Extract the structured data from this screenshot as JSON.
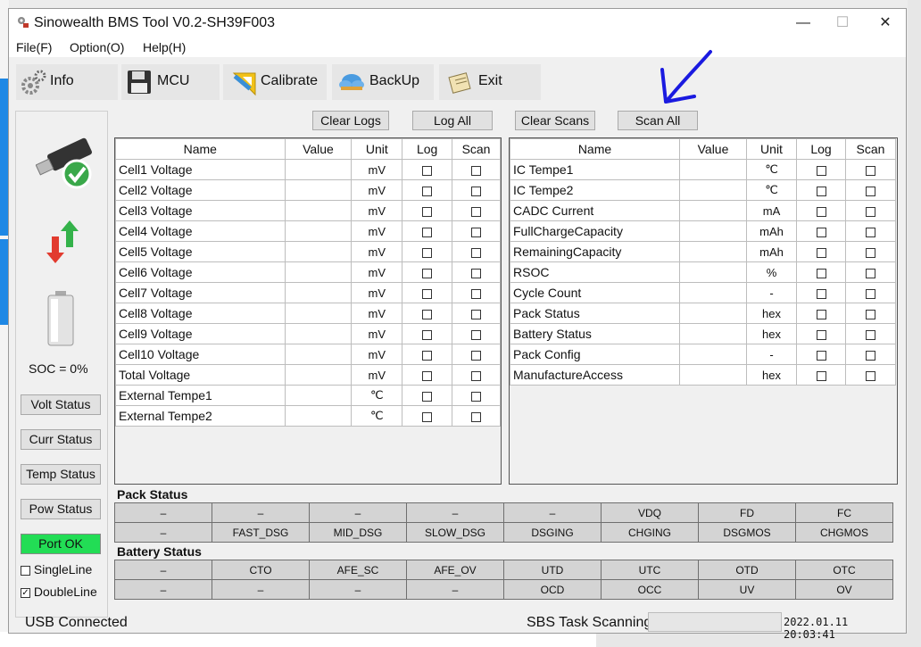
{
  "window": {
    "title": "Sinowealth BMS Tool V0.2-SH39F003",
    "controls": {
      "minimize": "—",
      "maximize": "☐",
      "close": "✕"
    }
  },
  "menu": [
    "File(F)",
    "Option(O)",
    "Help(H)"
  ],
  "toolbar": [
    {
      "label": "Info",
      "icon": "gear-icon"
    },
    {
      "label": "MCU",
      "icon": "floppy-disk-icon"
    },
    {
      "label": "Calibrate",
      "icon": "ruler-triangle-icon"
    },
    {
      "label": "BackUp",
      "icon": "cloud-icon"
    },
    {
      "label": "Exit",
      "icon": "exit-icon"
    }
  ],
  "actions": {
    "clear_logs": "Clear Logs",
    "log_all": "Log All",
    "clear_scans": "Clear Scans",
    "scan_all": "Scan All"
  },
  "columns": {
    "name": "Name",
    "value": "Value",
    "unit": "Unit",
    "log": "Log",
    "scan": "Scan"
  },
  "left_table": [
    {
      "name": "Cell1 Voltage",
      "value": "",
      "unit": "mV"
    },
    {
      "name": "Cell2 Voltage",
      "value": "",
      "unit": "mV"
    },
    {
      "name": "Cell3 Voltage",
      "value": "",
      "unit": "mV"
    },
    {
      "name": "Cell4 Voltage",
      "value": "",
      "unit": "mV"
    },
    {
      "name": "Cell5 Voltage",
      "value": "",
      "unit": "mV"
    },
    {
      "name": "Cell6 Voltage",
      "value": "",
      "unit": "mV"
    },
    {
      "name": "Cell7 Voltage",
      "value": "",
      "unit": "mV"
    },
    {
      "name": "Cell8 Voltage",
      "value": "",
      "unit": "mV"
    },
    {
      "name": "Cell9 Voltage",
      "value": "",
      "unit": "mV"
    },
    {
      "name": "Cell10 Voltage",
      "value": "",
      "unit": "mV"
    },
    {
      "name": "Total Voltage",
      "value": "",
      "unit": "mV"
    },
    {
      "name": "External Tempe1",
      "value": "",
      "unit": "℃"
    },
    {
      "name": "External Tempe2",
      "value": "",
      "unit": "℃"
    }
  ],
  "right_table": [
    {
      "name": "IC Tempe1",
      "value": "",
      "unit": "℃"
    },
    {
      "name": "IC Tempe2",
      "value": "",
      "unit": "℃"
    },
    {
      "name": "CADC Current",
      "value": "",
      "unit": "mA"
    },
    {
      "name": "FullChargeCapacity",
      "value": "",
      "unit": "mAh"
    },
    {
      "name": "RemainingCapacity",
      "value": "",
      "unit": "mAh"
    },
    {
      "name": "RSOC",
      "value": "",
      "unit": "%"
    },
    {
      "name": "Cycle Count",
      "value": "",
      "unit": "-"
    },
    {
      "name": "Pack Status",
      "value": "",
      "unit": "hex"
    },
    {
      "name": "Battery Status",
      "value": "",
      "unit": "hex"
    },
    {
      "name": "Pack Config",
      "value": "",
      "unit": "-"
    },
    {
      "name": "ManufactureAccess",
      "value": "",
      "unit": "hex"
    }
  ],
  "left_panel": {
    "soc_text": "SOC = 0%",
    "buttons": [
      "Volt Status",
      "Curr Status",
      "Temp Status",
      "Pow Status"
    ],
    "port_status": "Port OK",
    "port_color": "#22dd55",
    "singleline_label": "SingleLine",
    "singleline_checked": false,
    "doubleline_label": "DoubleLine",
    "doubleline_checked": true
  },
  "pack_status": {
    "title": "Pack Status",
    "rows": [
      [
        "–",
        "–",
        "–",
        "–",
        "–",
        "VDQ",
        "FD",
        "FC"
      ],
      [
        "–",
        "FAST_DSG",
        "MID_DSG",
        "SLOW_DSG",
        "DSGING",
        "CHGING",
        "DSGMOS",
        "CHGMOS"
      ]
    ]
  },
  "battery_status": {
    "title": "Battery Status",
    "rows": [
      [
        "–",
        "CTO",
        "AFE_SC",
        "AFE_OV",
        "UTD",
        "UTC",
        "OTD",
        "OTC"
      ],
      [
        "–",
        "–",
        "–",
        "–",
        "OCD",
        "OCC",
        "UV",
        "OV"
      ]
    ]
  },
  "statusbar": {
    "connection": "USB Connected",
    "task": "SBS Task Scanning",
    "datetime": "2022.01.11 20:03:41"
  },
  "annotation_color": "#1a1ae0"
}
